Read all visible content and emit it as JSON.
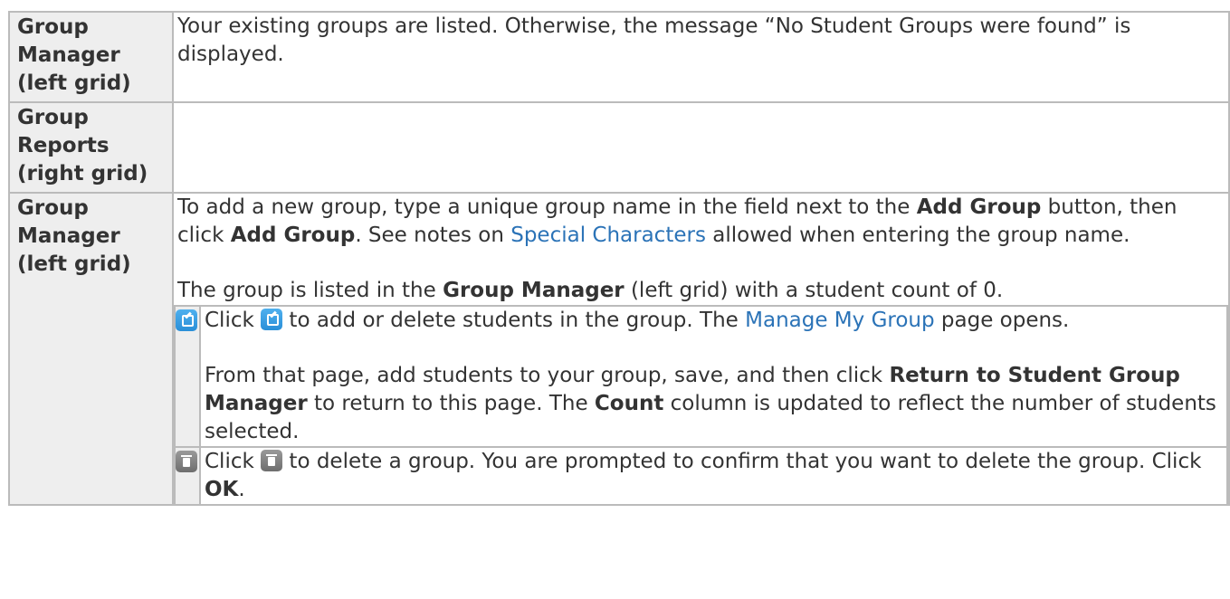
{
  "rows": [
    {
      "label_line1": "Group Manager",
      "label_line2": "(left grid)",
      "desc": "Your existing groups are listed. Otherwise, the message “No Student Groups were found” is displayed."
    },
    {
      "label_line1": "Group Reports",
      "label_line2": "(right grid)",
      "desc": ""
    },
    {
      "label_line1": "Group Manager",
      "label_line2": "(left grid)",
      "p1": {
        "t1": "To add a new group, type a unique group name in the field next to the ",
        "b1": "Add Group",
        "t2": " button, then click ",
        "b2": "Add Group",
        "t3": ". See notes on ",
        "link": "Special Characters",
        "t4": " allowed when entering the group name."
      },
      "p2": {
        "t1": "The group is listed in the ",
        "b1": "Group Manager",
        "t2": " (left grid) with a student count of 0."
      }
    }
  ],
  "inner_rows": [
    {
      "icon": "edit-icon",
      "p1": {
        "t1": "Click ",
        "t2": " to add or delete students in the group. The ",
        "link": "Manage My Group",
        "t3": " page opens."
      },
      "p2": {
        "t1": "From that page, add students to your group, save, and then click ",
        "b1": "Return to Student Group Manager",
        "t2": " to return to this page. The ",
        "b2": "Count",
        "t3": " column is updated to reflect the number of students selected."
      }
    },
    {
      "icon": "trash-icon",
      "p1": {
        "t1": "Click ",
        "t2": " to delete a group. You are prompted to confirm that you want to delete the group. Click ",
        "b1": "OK",
        "t3": "."
      }
    }
  ],
  "colors": {
    "border": "#bbbbbb",
    "label_bg": "#eeeeee",
    "text": "#333333",
    "link": "#2b73b7",
    "edit_icon": "#2a8fd8",
    "trash_icon": "#6e6e6e"
  }
}
